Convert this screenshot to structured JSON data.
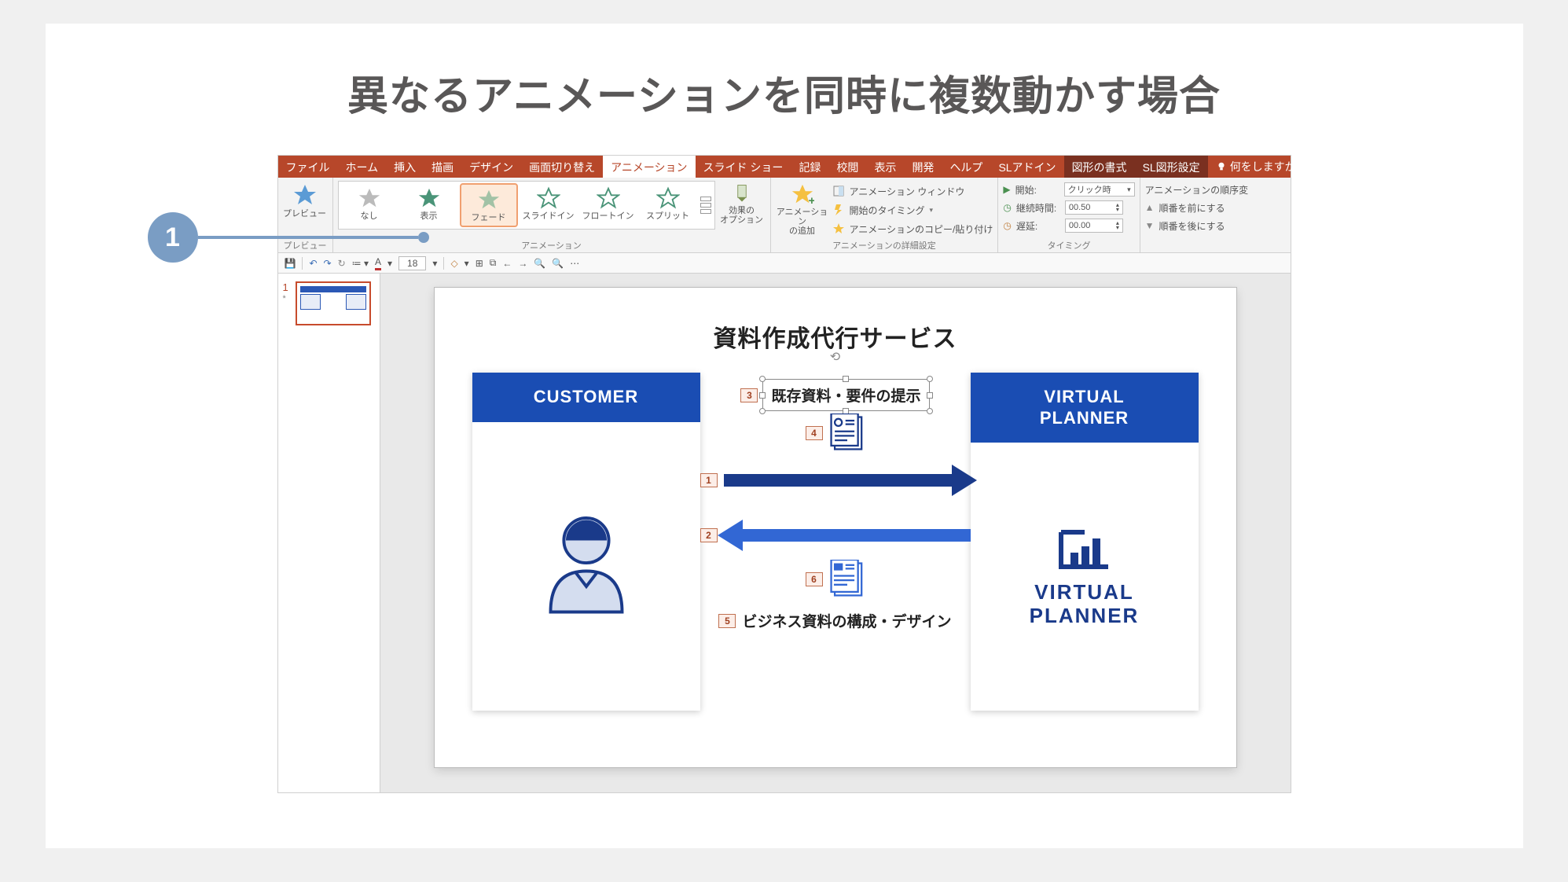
{
  "heading": "異なるアニメーションを同時に複数動かす場合",
  "callout_number": "1",
  "tabs": {
    "file": "ファイル",
    "home": "ホーム",
    "insert": "挿入",
    "draw": "描画",
    "design": "デザイン",
    "transitions": "画面切り替え",
    "animations": "アニメーション",
    "slideshow": "スライド ショー",
    "record": "記録",
    "review": "校閲",
    "view": "表示",
    "developer": "開発",
    "help": "ヘルプ",
    "sl_addin": "SLアドイン",
    "shape_format": "図形の書式",
    "sl_shape_settings": "SL図形設定",
    "tell_me": "何をしますか"
  },
  "ribbon": {
    "preview_group": "プレビュー",
    "preview": "プレビュー",
    "animation_group": "アニメーション",
    "gallery": {
      "none": "なし",
      "appear": "表示",
      "fade": "フェード",
      "slidein": "スライドイン",
      "floatin": "フロートイン",
      "split": "スプリット"
    },
    "effect_options": "効果の\nオプション",
    "advanced_group": "アニメーションの詳細設定",
    "add_animation": "アニメーション\nの追加",
    "animation_pane": "アニメーション ウィンドウ",
    "trigger": "開始のタイミング",
    "animation_painter": "アニメーションのコピー/貼り付け",
    "timing_group": "タイミング",
    "start_label": "開始:",
    "start_value": "クリック時",
    "duration_label": "継続時間:",
    "duration_value": "00.50",
    "delay_label": "遅延:",
    "delay_value": "00.00",
    "reorder_label": "アニメーションの順序変",
    "move_earlier": "順番を前にする",
    "move_later": "順番を後にする"
  },
  "qat": {
    "font_size": "18"
  },
  "thumb": {
    "num": "1",
    "star": "*"
  },
  "slide": {
    "title": "資料作成代行サービス",
    "customer": "CUSTOMER",
    "vp_line1": "VIRTUAL",
    "vp_line2": "PLANNER",
    "vp_logo_line1": "VIRTUAL",
    "vp_logo_line2": "PLANNER",
    "middle_top_text": "既存資料・要件の提示",
    "middle_bottom_text": "ビジネス資料の構成・デザイン",
    "tags": {
      "t1": "1",
      "t2": "2",
      "t3": "3",
      "t4": "4",
      "t5": "5",
      "t6": "6"
    }
  }
}
